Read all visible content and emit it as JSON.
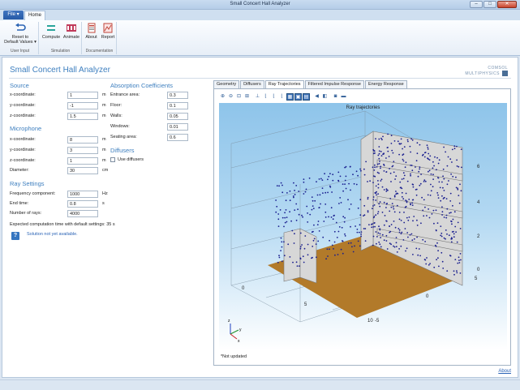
{
  "window": {
    "title": "Small Concert Hall Analyzer",
    "minimize": "–",
    "maximize": "□",
    "close": "✕"
  },
  "ribbon": {
    "file_tab": "File ▾",
    "home_tab": "Home",
    "groups": [
      {
        "label": "User Input",
        "buttons": [
          {
            "label": "Reset to\nDefault Values ▾",
            "icon": "undo-arrow-icon"
          }
        ]
      },
      {
        "label": "Simulation",
        "buttons": [
          {
            "label": "Compute",
            "icon": "equals-icon"
          },
          {
            "label": "Animate",
            "icon": "film-strip-icon"
          }
        ]
      },
      {
        "label": "Documentation",
        "buttons": [
          {
            "label": "About",
            "icon": "info-document-icon"
          },
          {
            "label": "Report",
            "icon": "report-icon"
          }
        ]
      }
    ]
  },
  "app": {
    "title": "Small Concert Hall Analyzer",
    "logo": "COMSOL\nMULTIPHYSICS",
    "source": {
      "heading": "Source",
      "fields": [
        {
          "label": "x-coordinate:",
          "value": "1",
          "unit": "m"
        },
        {
          "label": "y-coordinate:",
          "value": "-1",
          "unit": "m"
        },
        {
          "label": "z-coordinate:",
          "value": "1.5",
          "unit": "m"
        }
      ]
    },
    "microphone": {
      "heading": "Microphone",
      "fields": [
        {
          "label": "x-coordinate:",
          "value": "8",
          "unit": "m"
        },
        {
          "label": "y-coordinate:",
          "value": "3",
          "unit": "m"
        },
        {
          "label": "z-coordinate:",
          "value": "1",
          "unit": "m"
        },
        {
          "label": "Diameter:",
          "value": "30",
          "unit": "cm"
        }
      ]
    },
    "ray_settings": {
      "heading": "Ray Settings",
      "fields": [
        {
          "label": "Frequency component:",
          "value": "1000",
          "unit": "Hz"
        },
        {
          "label": "End time:",
          "value": "0.8",
          "unit": "s"
        },
        {
          "label": "Number of rays:",
          "value": "4000",
          "unit": ""
        }
      ]
    },
    "absorption": {
      "heading": "Absorption Coefficients",
      "fields": [
        {
          "label": "Entrance area:",
          "value": "0.3"
        },
        {
          "label": "Floor:",
          "value": "0.1"
        },
        {
          "label": "Walls:",
          "value": "0.05"
        },
        {
          "label": "Windows:",
          "value": "0.01"
        },
        {
          "label": "Seating area:",
          "value": "0.6"
        }
      ]
    },
    "diffusers": {
      "heading": "Diffusers",
      "use_label": "Use diffusers",
      "checked": false
    },
    "computation_time": "Expected computation time with default settings:  35 s",
    "solution_status": "Solution not yet available.",
    "info_icon": "?",
    "graphics_tabs": [
      "Geometry",
      "Diffusers",
      "Ray Trajectories",
      "Filtered Impulse Response",
      "Energy Response"
    ],
    "active_tab": 2,
    "toolbar_icons": [
      "zoom-in-icon",
      "zoom-out-icon",
      "zoom-box-icon",
      "zoom-extents-icon",
      "axis-orientation-icon",
      "xy-view-icon",
      "yz-view-icon",
      "zx-view-icon",
      "wireframe-icon",
      "solid-view-icon",
      "transparency-icon",
      "sound-icon",
      "scene-light-icon",
      "camera-icon",
      "print-icon"
    ],
    "plot": {
      "title": "Ray trajectories",
      "z_ticks": [
        "0",
        "2",
        "4",
        "6"
      ],
      "x_ticks": [
        "0",
        "5",
        "10"
      ],
      "y_ticks": [
        "-5",
        "0",
        "5"
      ],
      "axis_labels": [
        "z",
        "y",
        "x"
      ],
      "colors": {
        "rays": "#1a1f8f",
        "floor": "#b27a2a",
        "walls": "#d7d7d7"
      }
    },
    "not_updated": "*Not updated",
    "about_link": "About"
  }
}
